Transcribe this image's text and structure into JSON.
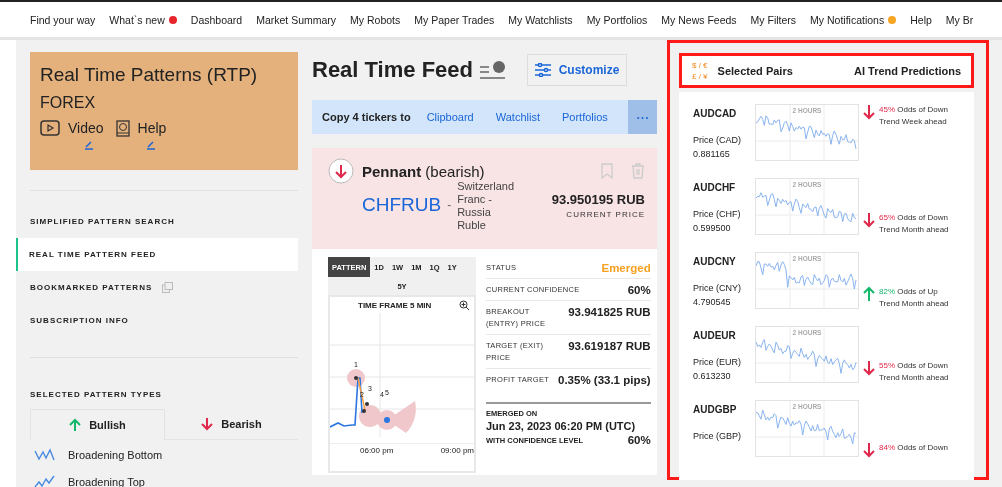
{
  "nav": [
    {
      "label": "Find your way"
    },
    {
      "label": "What`s new",
      "color": "#e8242b"
    },
    {
      "label": "Dashboard"
    },
    {
      "label": "Market Summary"
    },
    {
      "label": "My Robots"
    },
    {
      "label": "My Paper Trades"
    },
    {
      "label": "My Watchlists"
    },
    {
      "label": "My Portfolios"
    },
    {
      "label": "My News Feeds"
    },
    {
      "label": "My Filters"
    },
    {
      "label": "My Notifications",
      "color": "#f5a623"
    },
    {
      "label": "Help"
    },
    {
      "label": "My Br"
    }
  ],
  "sidebar": {
    "title": "Real Time Patterns (RTP)",
    "subtitle": "FOREX",
    "links": [
      {
        "label": "Video",
        "kind": "video"
      },
      {
        "label": "Help",
        "kind": "help"
      }
    ],
    "menu": [
      {
        "label": "SIMPLIFIED PATTERN SEARCH",
        "selected": false,
        "external": false
      },
      {
        "label": "REAL TIME PATTERN FEED",
        "selected": true,
        "external": false
      },
      {
        "label": "BOOKMARKED PATTERNS",
        "selected": false,
        "external": true
      },
      {
        "label": "SUBSCRIPTION INFO",
        "selected": false,
        "external": false
      }
    ],
    "types_heading": "SELECTED PATTERN TYPES",
    "type_tabs": [
      {
        "label": "Bullish",
        "up": true,
        "selected": true
      },
      {
        "label": "Bearish",
        "up": false,
        "selected": false
      }
    ],
    "patterns": [
      {
        "label": "Broadening Bottom"
      },
      {
        "label": "Broadening Top"
      }
    ]
  },
  "feed": {
    "title": "Real Time Feed",
    "customize": "Customize",
    "copy_bar": {
      "label": "Copy 4 tickers to",
      "actions": [
        "Clipboard",
        "Watchlist",
        "Portfolios"
      ],
      "more": "• • •"
    },
    "pattern": {
      "name": "Pennant",
      "qualifier": "(bearish)",
      "up": false,
      "ticker": "CHFRUB",
      "separator": "-",
      "pair_name": "Switzerland Franc - Russia Ruble",
      "price": "93.950195 RUB",
      "price_label": "CURRENT PRICE"
    },
    "timeframes": [
      {
        "label": "PATTERN",
        "selected": true
      },
      {
        "label": "1D",
        "selected": false
      },
      {
        "label": "1W",
        "selected": false
      },
      {
        "label": "1M",
        "selected": false
      },
      {
        "label": "1Q",
        "selected": false
      },
      {
        "label": "1Y",
        "selected": false
      },
      {
        "label": "5Y",
        "selected": false
      }
    ],
    "chart": {
      "title": "TIME FRAME 5 MIN",
      "points": [
        "1",
        "2",
        "3",
        "4",
        "5"
      ],
      "x_labels": [
        "06:00 pm",
        "09:00 pm"
      ]
    },
    "stats": [
      {
        "label": "STATUS",
        "value": "Emerged",
        "kind": "status"
      },
      {
        "label": "CURRENT CONFIDENCE",
        "value": "60%",
        "kind": "plain"
      },
      {
        "label": "BREAKOUT (ENTRY) PRICE",
        "value": "93.941825 RUB",
        "kind": "plain"
      },
      {
        "label": "TARGET (EXIT) PRICE",
        "value": "93.619187 RUB",
        "kind": "plain"
      },
      {
        "label": "PROFIT TARGET",
        "value": "0.35% (33.1 pips)",
        "kind": "plain"
      }
    ],
    "emerged": {
      "label": "EMERGED ON",
      "date": "Jun 23, 2023 06:20 PM (UTC)",
      "confidence_label": "WITH CONFIDENCE LEVEL",
      "confidence": "60%"
    }
  },
  "pairs": {
    "logo_top": "$ / €",
    "logo_bottom": "£ / ¥",
    "title": "Selected Pairs",
    "predictions_title": "AI Trend Predictions",
    "items": [
      {
        "symbol": "AUDCAD",
        "price_label": "Price (CAD)",
        "price": "0.881165",
        "chart_label": "2 HOURS",
        "up": false,
        "odds": "45%",
        "text": "Odds of Down Trend Week ahead"
      },
      {
        "symbol": "AUDCHF",
        "price_label": "Price (CHF)",
        "price": "0.599500",
        "chart_label": "2 HOURS",
        "up": false,
        "odds": "65%",
        "text": "Odds of Down Trend Month ahead"
      },
      {
        "symbol": "AUDCNY",
        "price_label": "Price (CNY)",
        "price": "4.790545",
        "chart_label": "2 HOURS",
        "up": true,
        "odds": "82%",
        "text": "Odds of Up Trend Month ahead"
      },
      {
        "symbol": "AUDEUR",
        "price_label": "Price (EUR)",
        "price": "0.613230",
        "chart_label": "2 HOURS",
        "up": false,
        "odds": "55%",
        "text": "Odds of Down Trend Month ahead"
      },
      {
        "symbol": "AUDGBP",
        "price_label": "Price (GBP)",
        "chart_label": "2 HOURS",
        "up": false,
        "odds": "84%",
        "text": "Odds of Down"
      }
    ]
  }
}
